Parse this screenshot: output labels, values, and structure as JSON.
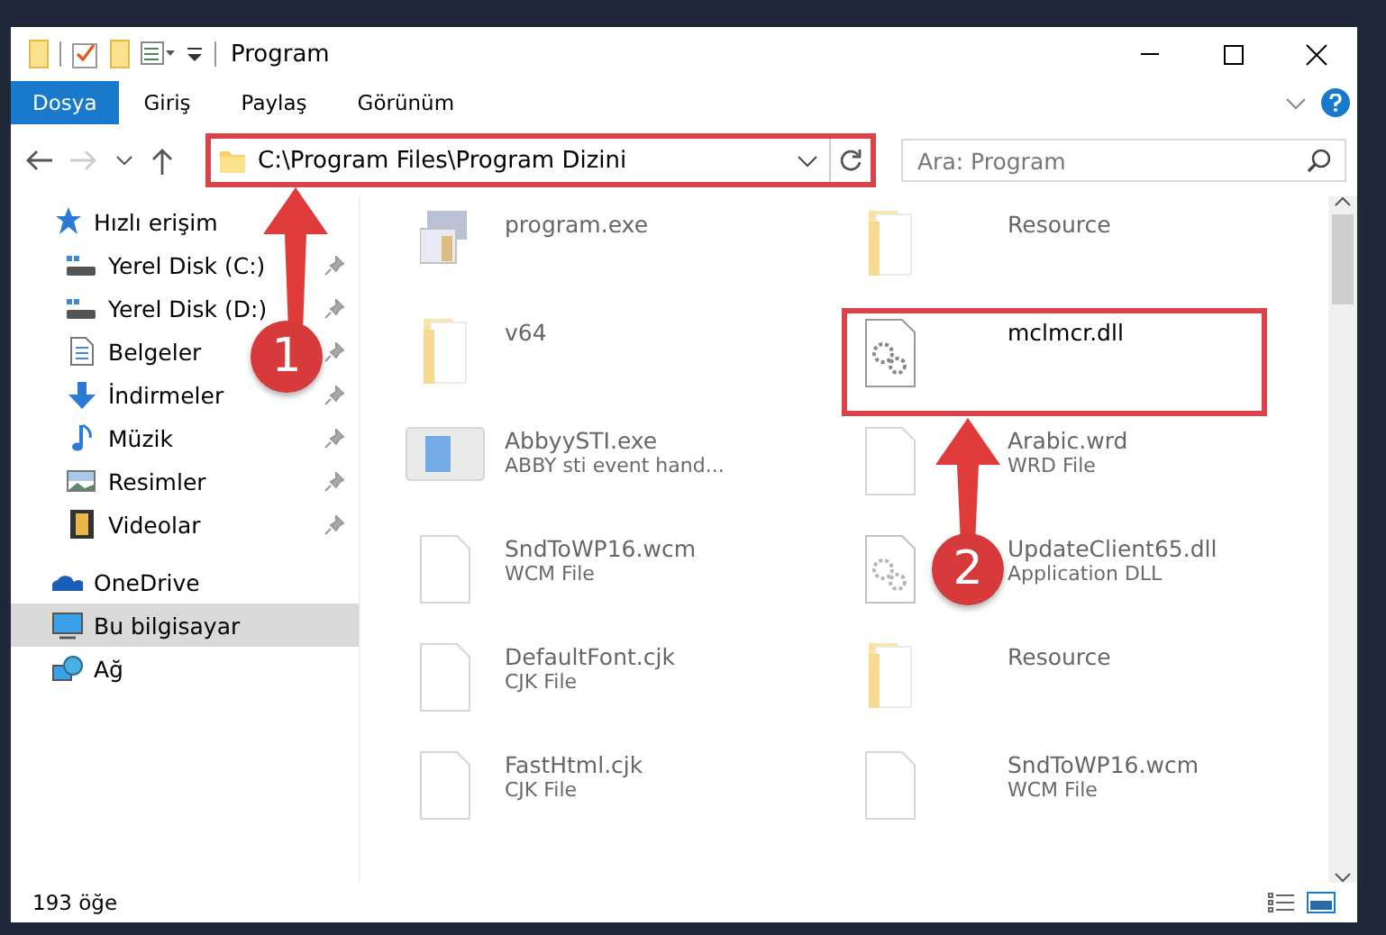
{
  "window": {
    "title": "Program"
  },
  "ribbon_tabs": [
    {
      "label": "Dosya",
      "selected": true
    },
    {
      "label": "Giriş",
      "selected": false
    },
    {
      "label": "Paylaş",
      "selected": false
    },
    {
      "label": "Görünüm",
      "selected": false
    }
  ],
  "address": {
    "path": "C:\\Program Files\\Program Dizini",
    "highlighted": true
  },
  "search": {
    "placeholder": "Ara: Program"
  },
  "sidebar": {
    "items": [
      {
        "label": "Hızlı erişim",
        "kind": "star",
        "selected": false,
        "children": [
          {
            "label": "Yerel Disk (C:)",
            "kind": "drive",
            "pinned": true,
            "selected": false
          },
          {
            "label": "Yerel Disk (D:)",
            "kind": "drive",
            "pinned": true,
            "selected": false
          },
          {
            "label": "Belgeler",
            "kind": "doc",
            "pinned": true,
            "selected": false
          },
          {
            "label": "İndirmeler",
            "kind": "download",
            "pinned": true,
            "selected": false
          },
          {
            "label": "Müzik",
            "kind": "music",
            "pinned": true,
            "selected": false
          },
          {
            "label": "Resimler",
            "kind": "image",
            "pinned": true,
            "selected": false
          },
          {
            "label": "Videolar",
            "kind": "film",
            "pinned": true,
            "selected": false
          }
        ]
      },
      {
        "label": "OneDrive",
        "kind": "cloud",
        "selected": false
      },
      {
        "label": "Bu bilgisayar",
        "kind": "monitor",
        "selected": true
      },
      {
        "label": "Ağ",
        "kind": "network",
        "selected": false
      }
    ]
  },
  "files": [
    {
      "name": "program.exe",
      "kind": "exe",
      "faded": true
    },
    {
      "name": "Resource",
      "kind": "folder",
      "faded": true
    },
    {
      "name": "v64",
      "kind": "folder",
      "faded": true
    },
    {
      "name": "mclmcr.dll",
      "kind": "dll",
      "faded": false,
      "highlighted": true
    },
    {
      "name": "AbbyySTI.exe",
      "type": "ABBY sti event hand...",
      "kind": "app",
      "faded": true
    },
    {
      "name": "Arabic.wrd",
      "type": "WRD File",
      "kind": "file",
      "faded": true
    },
    {
      "name": "SndToWP16.wcm",
      "type": "WCM File",
      "kind": "file",
      "faded": true
    },
    {
      "name": "UpdateClient65.dll",
      "type": "Application DLL",
      "kind": "dll",
      "faded": true
    },
    {
      "name": "DefaultFont.cjk",
      "type": "CJK File",
      "kind": "file",
      "faded": true
    },
    {
      "name": "Resource",
      "kind": "folder",
      "faded": true
    },
    {
      "name": "FastHtml.cjk",
      "type": "CJK File",
      "kind": "file",
      "faded": true
    },
    {
      "name": "SndToWP16.wcm",
      "type": "WCM File",
      "kind": "file",
      "faded": true
    }
  ],
  "status_bar": {
    "count": "193 öğe"
  },
  "annotations": [
    {
      "number": "1"
    },
    {
      "number": "2"
    }
  ]
}
